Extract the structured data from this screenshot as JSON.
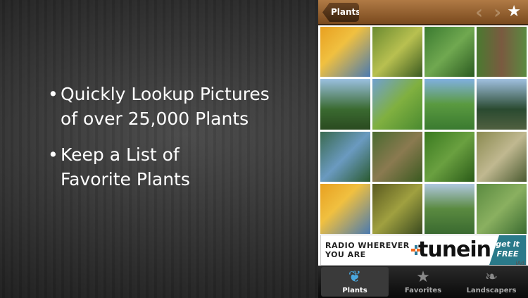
{
  "bullets": [
    "Quickly Lookup Pictures of over 25,000 Plants",
    "Keep a List of Favorite Plants"
  ],
  "bullet_lines": [
    [
      "Quickly Lookup Pictures",
      "of over 25,000 Plants"
    ],
    [
      "Keep a List of",
      "Favorite Plants"
    ]
  ],
  "nav": {
    "back_label": "Plants",
    "prev_icon": "chevron-left-icon",
    "next_icon": "chevron-right-icon",
    "favorite_icon": "star-icon"
  },
  "tiles": [
    "linear-gradient(135deg,#e8a020,#f0c040 40%,#4a7ab0)",
    "linear-gradient(135deg,#6a8a30,#b8c050,#3a5a20)",
    "linear-gradient(135deg,#3a7a30,#70a850,#2a5a20)",
    "linear-gradient(90deg,#4a7a30,#7a5a40 50%,#5a8a40)",
    "linear-gradient(#9ac0e0,#3a6a30 60%,#2a4a20)",
    "linear-gradient(135deg,#70a0d0,#80b040,#4a8a30)",
    "linear-gradient(#80b0e0,#5a9a40 50%,#3a7a30)",
    "linear-gradient(#a0c0e0,#2a4a30 60%,#506040)",
    "linear-gradient(135deg,#3a6a50,#6a9ac0,#2a5a30)",
    "linear-gradient(135deg,#4a6a30,#8a7a50,#3a5a20)",
    "linear-gradient(135deg,#3a7a20,#6aa040,#2a5a18)",
    "linear-gradient(135deg,#8a8a50,#c0b890,#4a5a30)",
    "linear-gradient(135deg,#e8a020,#f0c040 40%,#4a7ab0)",
    "linear-gradient(135deg,#5a5a20,#a0a040,#3a4a20)",
    "linear-gradient(#b0c8e0,#5a8a40 50%,#3a6a30)",
    "linear-gradient(135deg,#5a8a40,#8ab060,#3a6a30)"
  ],
  "ad": {
    "line1": "RADIO WHEREVER",
    "line2": "YOU ARE",
    "brand": "tunein",
    "cta1": "get it",
    "cta2": "FREE",
    "iad": "iAd"
  },
  "tabs": [
    {
      "label": "Plants",
      "icon": "plant-icon",
      "active": true
    },
    {
      "label": "Favorites",
      "icon": "star-icon"
    },
    {
      "label": "Landscapers",
      "icon": "tree-icon"
    }
  ]
}
